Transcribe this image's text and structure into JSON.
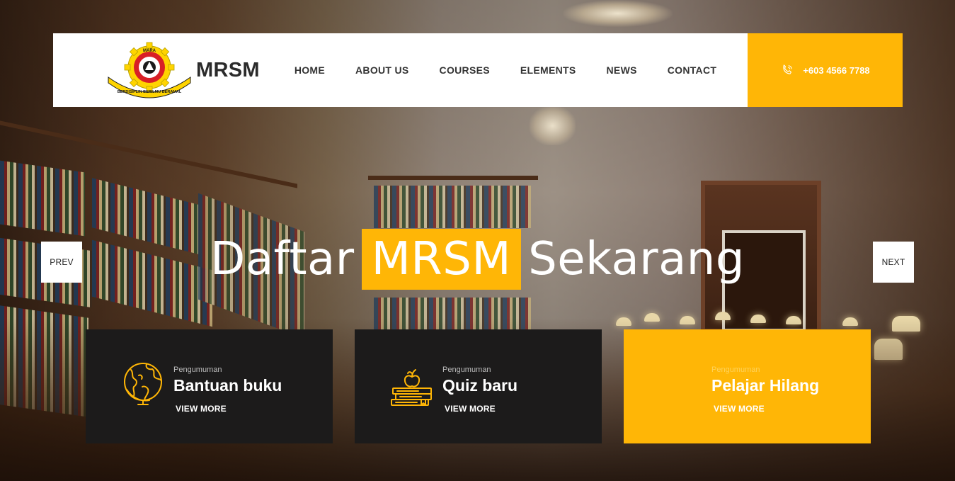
{
  "header": {
    "brand": "MRSM",
    "emblem": {
      "top_text": "MARA",
      "ribbon_text": "BERDISIPLIN BERILMU BERAMAL"
    },
    "nav": [
      {
        "label": "HOME"
      },
      {
        "label": "ABOUT US"
      },
      {
        "label": "COURSES"
      },
      {
        "label": "ELEMENTS"
      },
      {
        "label": "NEWS"
      },
      {
        "label": "CONTACT"
      }
    ],
    "phone": "+603 4566 7788",
    "phone_icon": "phone-icon"
  },
  "hero": {
    "title_before": "Daftar",
    "title_highlight": "MRSM",
    "title_after": "Sekarang",
    "prev_label": "PREV",
    "next_label": "NEXT"
  },
  "cards": [
    {
      "kicker": "Pengumuman",
      "title": "Bantuan buku",
      "more": "VIEW MORE",
      "icon": "globe-icon"
    },
    {
      "kicker": "Pengumuman",
      "title": "Quiz baru",
      "more": "VIEW MORE",
      "icon": "books-apple-icon"
    },
    {
      "kicker": "Pengumuman",
      "title": "Pelajar Hilang",
      "more": "VIEW MORE",
      "icon": "none"
    }
  ],
  "colors": {
    "accent": "#ffb606",
    "card_dark": "#1c1b1b",
    "header_bg": "#ffffff",
    "text_dark": "#333333"
  }
}
